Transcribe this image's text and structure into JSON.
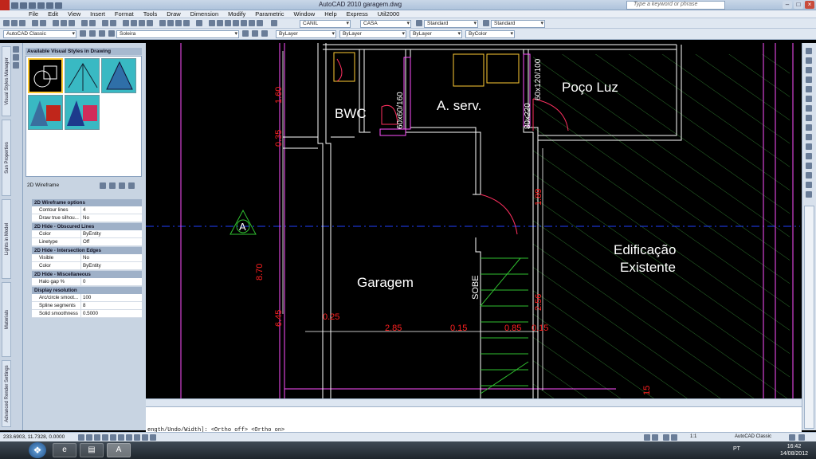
{
  "app": {
    "title": "AutoCAD 2010  garagem.dwg",
    "search_placeholder": "Type a keyword or phrase",
    "brand_color": "#c0261b"
  },
  "menu": [
    "File",
    "Edit",
    "View",
    "Insert",
    "Format",
    "Tools",
    "Draw",
    "Dimension",
    "Modify",
    "Parametric",
    "Window",
    "Help",
    "Express",
    "Util2000"
  ],
  "toolbar": {
    "layer_combo": "CANIL",
    "layer_combo2": "CASA",
    "textstyle": "Standard",
    "dimstyle": "Standard",
    "workspace": "AutoCAD Classic",
    "layer_current": "Soleira",
    "color": "ByLayer",
    "linetype": "ByLayer",
    "lineweight": "ByLayer",
    "plotstyle": "ByColor"
  },
  "left_tabs": [
    "Visual Styles Manager",
    "Sun Properties",
    "Lights in Model",
    "Materials",
    "Advanced Render Settings",
    "Visual Styles Manager"
  ],
  "palette": {
    "heading": "Available Visual Styles in Drawing",
    "current_style": "2D Wireframe",
    "sections": [
      {
        "title": "2D Wireframe options",
        "rows": [
          [
            "Contour lines",
            "4"
          ],
          [
            "Draw true silhou...",
            "No"
          ]
        ]
      },
      {
        "title": "2D Hide - Obscured Lines",
        "rows": [
          [
            "Color",
            "ByEntity"
          ],
          [
            "Linetype",
            "Off"
          ]
        ]
      },
      {
        "title": "2D Hide - Intersection Edges",
        "rows": [
          [
            "Visible",
            "No"
          ],
          [
            "Color",
            "ByEntity"
          ]
        ]
      },
      {
        "title": "2D Hide - Miscellaneous",
        "rows": [
          [
            "Halo gap %",
            "0"
          ]
        ]
      },
      {
        "title": "Display resolution",
        "rows": [
          [
            "Arc/circle smoot...",
            "100"
          ],
          [
            "Spline segments",
            "8"
          ],
          [
            "Solid smoothness",
            "0.5000"
          ]
        ]
      }
    ]
  },
  "drawing": {
    "rooms": {
      "bwc": "BWC",
      "aserv": "A. serv.",
      "poco": "Poço Luz",
      "garagem": "Garagem",
      "edif1": "Edificação",
      "edif2": "Existente",
      "sobe": "SOBE",
      "section_mark": "A"
    },
    "dims": {
      "d160": "1.60",
      "d035": "0.35",
      "d870": "8.70",
      "d645": "6.45",
      "d025": "0.25",
      "d285": "2.85",
      "d015a": "0.15",
      "d085": "0.85",
      "d015b": "0.15",
      "d189": "1.89",
      "d256": "2.56",
      "w6060": "60x60/160",
      "w80220": "80x220",
      "w60120": "60x120/100",
      "edge": "15"
    },
    "colors": {
      "wall": "#ffffff",
      "door": "#ff3060",
      "window": "#ff50ff",
      "dim": "#ff2020",
      "hatch": "#2a6e2a",
      "green": "#30c030",
      "axis": "#2040ff"
    }
  },
  "command": {
    "line": "ength/Undo/Width]:  <Ortho off>  <Ortho on>"
  },
  "status": {
    "coords": "233.6903, 11.7328, 0.0000",
    "scale": "1:1",
    "workspace": "AutoCAD Classic"
  },
  "taskbar": {
    "lang": "PT",
    "time": "16:42",
    "date": "14/08/2012"
  }
}
